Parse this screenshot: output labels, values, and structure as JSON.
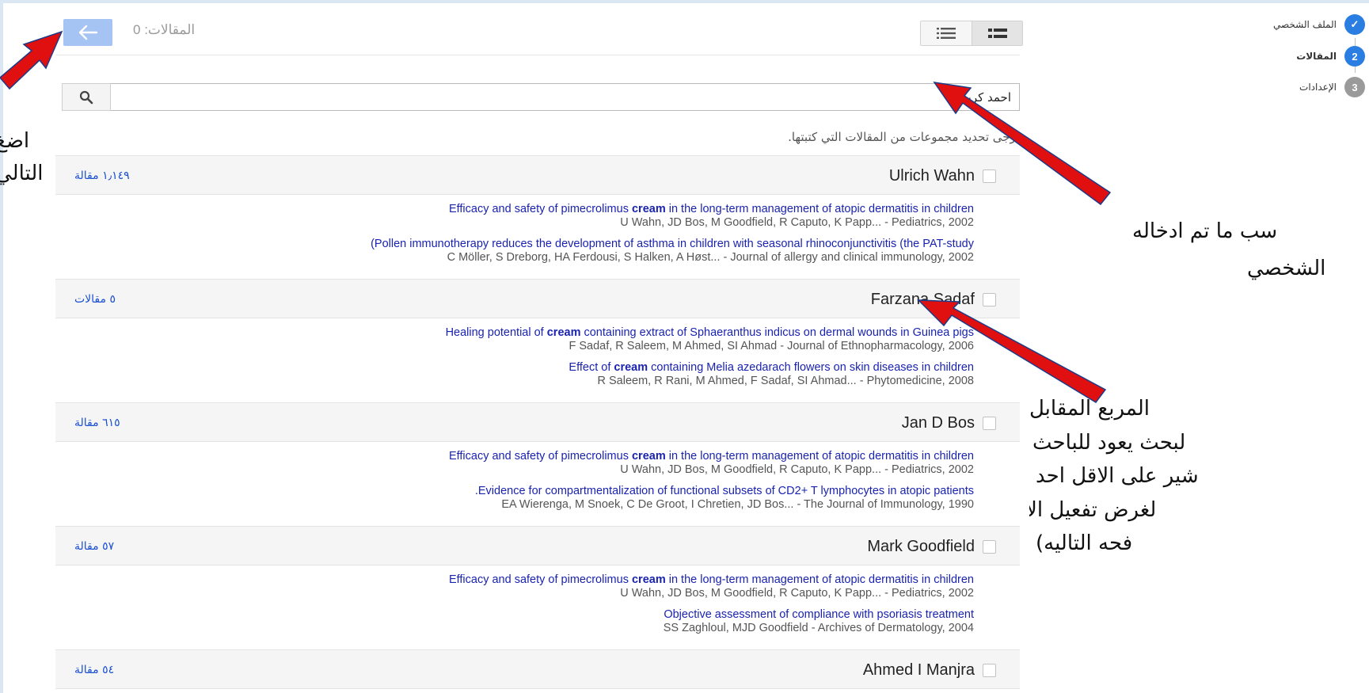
{
  "colors": {
    "accent": "#2a7de1",
    "link": "#1a23b0",
    "arrow": "#e01010"
  },
  "topbar": {
    "count_label": "المقالات: 0"
  },
  "search": {
    "value": "احمد كريم"
  },
  "hint": "يُرجى تحديد مجموعات من المقالات التي كتبتها.",
  "stepper": [
    {
      "label": "الملف الشخصي",
      "marker": "✓",
      "state": "done"
    },
    {
      "label": "المقالات",
      "marker": "2",
      "state": "active"
    },
    {
      "label": "الإعدادات",
      "marker": "3",
      "state": "idle"
    }
  ],
  "groups": [
    {
      "name": "Ulrich Wahn",
      "count": "١٫١٤٩ مقالة",
      "articles": [
        {
          "title_pre": "Efficacy and safety of pimecrolimus ",
          "title_bold": "cream",
          "title_post": " in the long-term management of atopic dermatitis in children",
          "meta": "U Wahn, JD Bos, M Goodfield, R Caputo, K Papp... - Pediatrics, 2002"
        },
        {
          "title_pre": "(Pollen immunotherapy reduces the development of asthma in children with seasonal rhinoconjunctivitis (the PAT-study",
          "title_bold": "",
          "title_post": "",
          "meta": "C Möller, S Dreborg, HA Ferdousi, S Halken, A Høst... - Journal of allergy and clinical immunology, 2002"
        }
      ]
    },
    {
      "name": "Farzana Sadaf",
      "count": "٥ مقالات",
      "articles": [
        {
          "title_pre": "Healing potential of ",
          "title_bold": "cream",
          "title_post": " containing extract of Sphaeranthus indicus on dermal wounds in Guinea pigs",
          "meta": "F Sadaf, R Saleem, M Ahmed, SI Ahmad - Journal of Ethnopharmacology, 2006"
        },
        {
          "title_pre": "Effect of ",
          "title_bold": "cream",
          "title_post": " containing Melia azedarach flowers on skin diseases in children",
          "meta": "R Saleem, R Rani, M Ahmed, F Sadaf, SI Ahmad... - Phytomedicine, 2008"
        }
      ]
    },
    {
      "name": "Jan D Bos",
      "count": "٦١٥ مقالة",
      "articles": [
        {
          "title_pre": "Efficacy and safety of pimecrolimus ",
          "title_bold": "cream",
          "title_post": " in the long-term management of atopic dermatitis in children",
          "meta": "U Wahn, JD Bos, M Goodfield, R Caputo, K Papp... - Pediatrics, 2002"
        },
        {
          "title_pre": ".Evidence for compartmentalization of functional subsets of CD2+ T lymphocytes in atopic patients",
          "title_bold": "",
          "title_post": "",
          "meta": "EA Wierenga, M Snoek, C De Groot, I Chretien, JD Bos... - The Journal of Immunology, 1990"
        }
      ]
    },
    {
      "name": "Mark Goodfield",
      "count": "٥٧ مقالة",
      "articles": [
        {
          "title_pre": "Efficacy and safety of pimecrolimus ",
          "title_bold": "cream",
          "title_post": " in the long-term management of atopic dermatitis in children",
          "meta": "U Wahn, JD Bos, M Goodfield, R Caputo, K Papp... - Pediatrics, 2002"
        },
        {
          "title_pre": "Objective assessment of compliance with psoriasis treatment",
          "title_bold": "",
          "title_post": "",
          "meta": "SS Zaghloul, MJD Goodfield - Archives of Dermatology, 2004"
        }
      ]
    },
    {
      "name": "Ahmed I Manjra",
      "count": "٥٤ مقالة",
      "articles": []
    }
  ],
  "annotations": {
    "left_lines": [
      "اضغ",
      "التالي"
    ],
    "right_top_lines": [
      "سب ما تم ادخاله",
      "الشخصي"
    ],
    "right_bottom_lines": [
      "المربع المقابل للبحث",
      "لبحث يعود للباحث",
      "شير على الاقل احد",
      "لغرض تفعيل الانتقال",
      "فحه التاليه)"
    ]
  }
}
